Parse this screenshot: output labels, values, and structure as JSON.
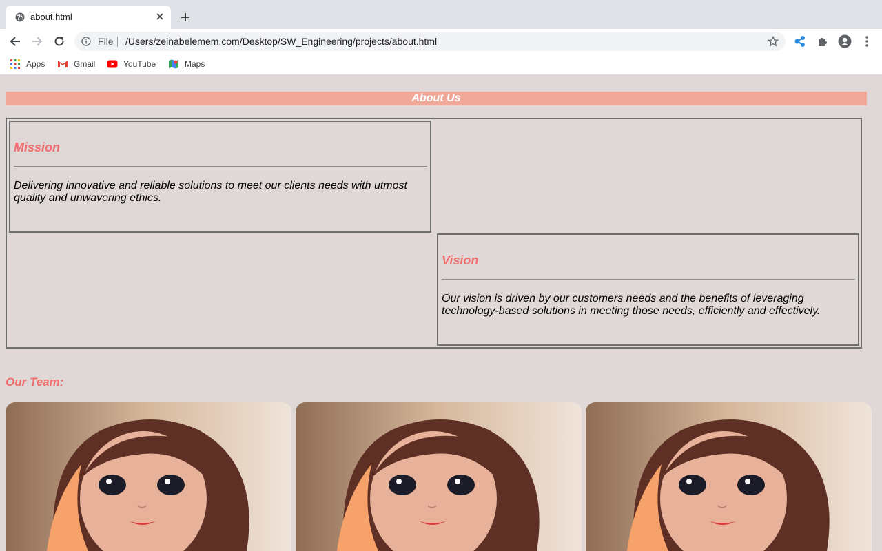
{
  "browser": {
    "tab_title": "about.html",
    "omnibox_label": "File",
    "url": "/Users/zeinabelemem.com/Desktop/SW_Engineering/projects/about.html",
    "bookmarks": [
      {
        "label": "Apps",
        "icon": "apps-grid-icon"
      },
      {
        "label": "Gmail",
        "icon": "gmail-icon"
      },
      {
        "label": "YouTube",
        "icon": "youtube-icon"
      },
      {
        "label": "Maps",
        "icon": "maps-icon"
      }
    ]
  },
  "page": {
    "banner_title": "About Us",
    "mission": {
      "heading": "Mission",
      "text": "Delivering innovative and reliable solutions to meet our clients needs with utmost quality and unwavering ethics."
    },
    "vision": {
      "heading": "Vision",
      "text": "Our vision is driven by our customers needs and the benefits of leveraging technology-based solutions in meeting those needs, efficiently and effectively."
    },
    "team_heading": "Our Team:"
  },
  "colors": {
    "page_bg": "#e0d8d6",
    "banner_bg": "#f0a898",
    "heading_accent": "#f07070"
  }
}
